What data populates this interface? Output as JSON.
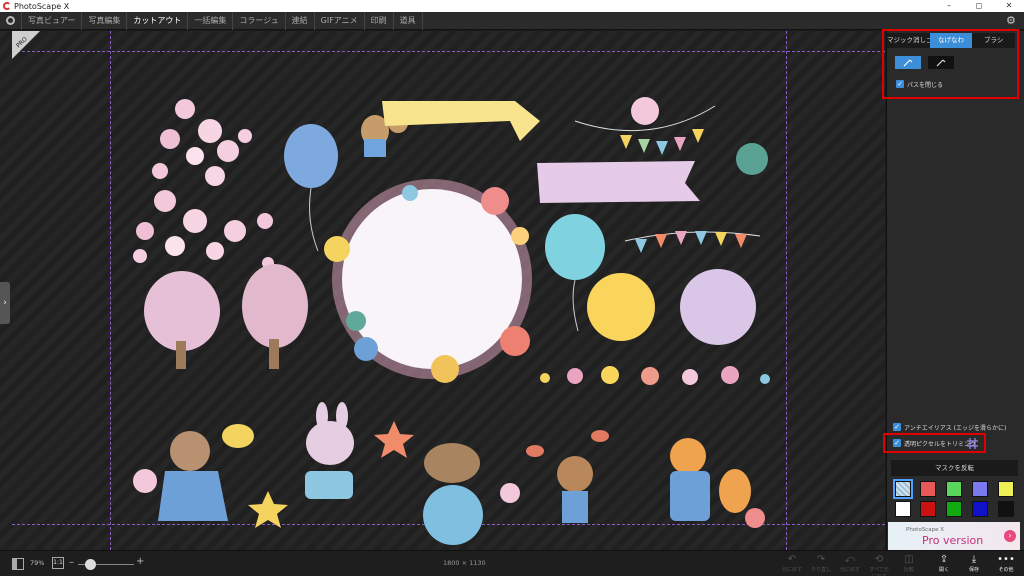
{
  "window": {
    "title": "PhotoScape X",
    "controls": [
      "–",
      "◻",
      "✕"
    ]
  },
  "menu": {
    "tabs": [
      "写真ビュアー",
      "写真編集",
      "カットアウト",
      "一括編集",
      "コラージュ",
      "連結",
      "GIFアニメ",
      "印刷",
      "道具"
    ],
    "active_tab": "カットアウト"
  },
  "panel": {
    "modes": [
      "マジック消しゴム",
      "なげなわ",
      "ブラシ"
    ],
    "active_mode": "なげなわ",
    "close_path_label": "パスを閉じる",
    "antialias_label": "アンチエイリアス (エッジを滑らかに)",
    "trim_label": "透明ピクセルをトリミング",
    "invert_mask_label": "マスクを反転",
    "mask_colors": [
      "#cfe3ee",
      "#e85a5a",
      "#5ad65a",
      "#7a7aee",
      "#eeee55",
      "#ffffff",
      "#cc1111",
      "#11aa11",
      "#1111cc",
      "#111111"
    ],
    "pro_banner_small": "PhotoScape X",
    "pro_banner_large": "Pro version"
  },
  "canvas": {
    "pro_badge": "PRO"
  },
  "bottom": {
    "zoom": "79%",
    "zoom_reset": "1:1",
    "zoom_fraction": 0.22,
    "dimensions": "1800 × 1130",
    "actions": [
      {
        "label": "元に戻す",
        "icon": "↶",
        "enabled": false
      },
      {
        "label": "やり直し",
        "icon": "↷",
        "enabled": false
      },
      {
        "label": "元に戻す",
        "icon": "⤺",
        "enabled": false
      },
      {
        "label": "すべて元に戻す",
        "icon": "⟲",
        "enabled": false
      },
      {
        "label": "比較",
        "icon": "◫",
        "enabled": false
      },
      {
        "label": "開く",
        "icon": "⇪",
        "enabled": true
      },
      {
        "label": "保存",
        "icon": "⤓",
        "enabled": true
      },
      {
        "label": "その他",
        "icon": "•••",
        "enabled": true
      }
    ]
  }
}
